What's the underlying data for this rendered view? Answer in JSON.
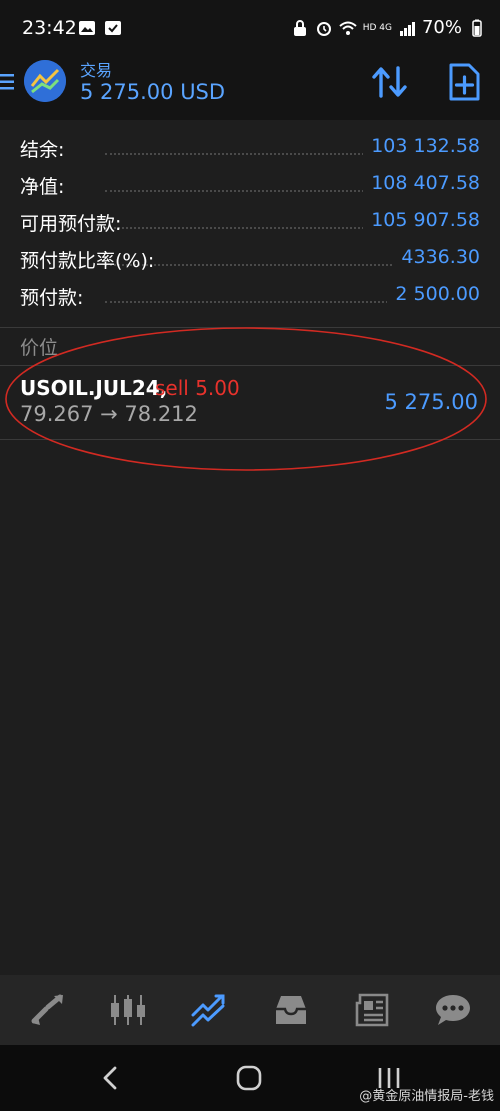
{
  "status_bar": {
    "time": "23:42",
    "network": "HD 4G",
    "battery": "70%",
    "icons": [
      "image-icon",
      "check-icon",
      "lock-icon",
      "alarm-icon",
      "wifi-icon",
      "signal-icon",
      "battery-icon"
    ]
  },
  "header": {
    "title": "交易",
    "balance": "5 275.00 USD",
    "icons": [
      "menu-icon",
      "app-logo",
      "sort-icon",
      "new-order-icon"
    ]
  },
  "summary": {
    "rows": [
      {
        "label": "结余:",
        "value": "103 132.58"
      },
      {
        "label": "净值:",
        "value": "108 407.58"
      },
      {
        "label": "可用预付款:",
        "value": "105 907.58"
      },
      {
        "label": "预付款比率(%):",
        "value": "4336.30"
      },
      {
        "label": "预付款:",
        "value": "2 500.00"
      }
    ]
  },
  "positions": {
    "section_label": "价位",
    "items": [
      {
        "symbol": "USOIL.JUL24,",
        "side": "sell 5.00",
        "prices": "79.267 → 78.212",
        "profit": "5 275.00"
      }
    ]
  },
  "bottom_nav": {
    "items": [
      "quotes-icon",
      "chart-icon",
      "trade-icon",
      "history-icon",
      "news-icon",
      "messages-icon"
    ],
    "active": "trade-icon"
  },
  "watermark": "@黄金原油情报局-老钱",
  "colors": {
    "accent": "#4c9bff",
    "sell": "#e8322c",
    "background": "#1e1e1e",
    "header": "#141414",
    "annotation": "#d22a22"
  }
}
